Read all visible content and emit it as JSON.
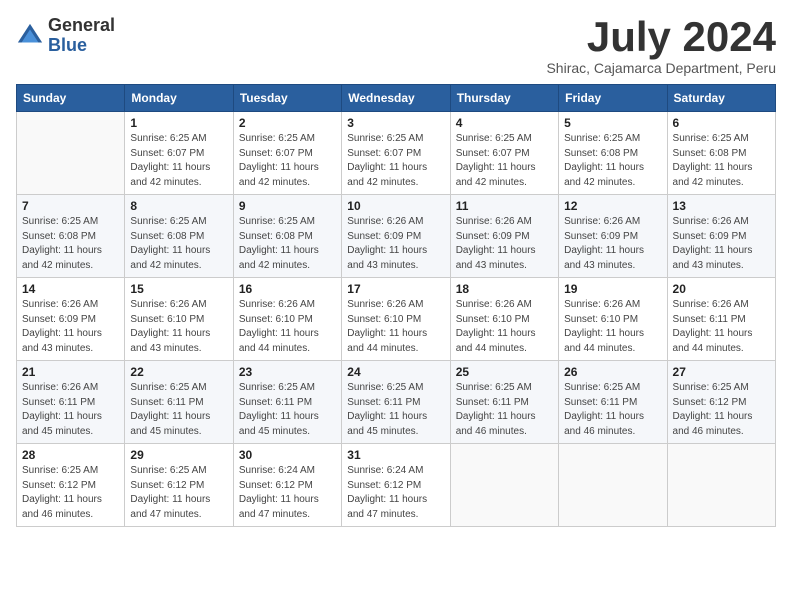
{
  "header": {
    "logo_general": "General",
    "logo_blue": "Blue",
    "month_title": "July 2024",
    "subtitle": "Shirac, Cajamarca Department, Peru"
  },
  "days_of_week": [
    "Sunday",
    "Monday",
    "Tuesday",
    "Wednesday",
    "Thursday",
    "Friday",
    "Saturday"
  ],
  "weeks": [
    [
      {
        "day": "",
        "info": ""
      },
      {
        "day": "1",
        "info": "Sunrise: 6:25 AM\nSunset: 6:07 PM\nDaylight: 11 hours\nand 42 minutes."
      },
      {
        "day": "2",
        "info": "Sunrise: 6:25 AM\nSunset: 6:07 PM\nDaylight: 11 hours\nand 42 minutes."
      },
      {
        "day": "3",
        "info": "Sunrise: 6:25 AM\nSunset: 6:07 PM\nDaylight: 11 hours\nand 42 minutes."
      },
      {
        "day": "4",
        "info": "Sunrise: 6:25 AM\nSunset: 6:07 PM\nDaylight: 11 hours\nand 42 minutes."
      },
      {
        "day": "5",
        "info": "Sunrise: 6:25 AM\nSunset: 6:08 PM\nDaylight: 11 hours\nand 42 minutes."
      },
      {
        "day": "6",
        "info": "Sunrise: 6:25 AM\nSunset: 6:08 PM\nDaylight: 11 hours\nand 42 minutes."
      }
    ],
    [
      {
        "day": "7",
        "info": "Sunrise: 6:25 AM\nSunset: 6:08 PM\nDaylight: 11 hours\nand 42 minutes."
      },
      {
        "day": "8",
        "info": "Sunrise: 6:25 AM\nSunset: 6:08 PM\nDaylight: 11 hours\nand 42 minutes."
      },
      {
        "day": "9",
        "info": "Sunrise: 6:25 AM\nSunset: 6:08 PM\nDaylight: 11 hours\nand 42 minutes."
      },
      {
        "day": "10",
        "info": "Sunrise: 6:26 AM\nSunset: 6:09 PM\nDaylight: 11 hours\nand 43 minutes."
      },
      {
        "day": "11",
        "info": "Sunrise: 6:26 AM\nSunset: 6:09 PM\nDaylight: 11 hours\nand 43 minutes."
      },
      {
        "day": "12",
        "info": "Sunrise: 6:26 AM\nSunset: 6:09 PM\nDaylight: 11 hours\nand 43 minutes."
      },
      {
        "day": "13",
        "info": "Sunrise: 6:26 AM\nSunset: 6:09 PM\nDaylight: 11 hours\nand 43 minutes."
      }
    ],
    [
      {
        "day": "14",
        "info": "Sunrise: 6:26 AM\nSunset: 6:09 PM\nDaylight: 11 hours\nand 43 minutes."
      },
      {
        "day": "15",
        "info": "Sunrise: 6:26 AM\nSunset: 6:10 PM\nDaylight: 11 hours\nand 43 minutes."
      },
      {
        "day": "16",
        "info": "Sunrise: 6:26 AM\nSunset: 6:10 PM\nDaylight: 11 hours\nand 44 minutes."
      },
      {
        "day": "17",
        "info": "Sunrise: 6:26 AM\nSunset: 6:10 PM\nDaylight: 11 hours\nand 44 minutes."
      },
      {
        "day": "18",
        "info": "Sunrise: 6:26 AM\nSunset: 6:10 PM\nDaylight: 11 hours\nand 44 minutes."
      },
      {
        "day": "19",
        "info": "Sunrise: 6:26 AM\nSunset: 6:10 PM\nDaylight: 11 hours\nand 44 minutes."
      },
      {
        "day": "20",
        "info": "Sunrise: 6:26 AM\nSunset: 6:11 PM\nDaylight: 11 hours\nand 44 minutes."
      }
    ],
    [
      {
        "day": "21",
        "info": "Sunrise: 6:26 AM\nSunset: 6:11 PM\nDaylight: 11 hours\nand 45 minutes."
      },
      {
        "day": "22",
        "info": "Sunrise: 6:25 AM\nSunset: 6:11 PM\nDaylight: 11 hours\nand 45 minutes."
      },
      {
        "day": "23",
        "info": "Sunrise: 6:25 AM\nSunset: 6:11 PM\nDaylight: 11 hours\nand 45 minutes."
      },
      {
        "day": "24",
        "info": "Sunrise: 6:25 AM\nSunset: 6:11 PM\nDaylight: 11 hours\nand 45 minutes."
      },
      {
        "day": "25",
        "info": "Sunrise: 6:25 AM\nSunset: 6:11 PM\nDaylight: 11 hours\nand 46 minutes."
      },
      {
        "day": "26",
        "info": "Sunrise: 6:25 AM\nSunset: 6:11 PM\nDaylight: 11 hours\nand 46 minutes."
      },
      {
        "day": "27",
        "info": "Sunrise: 6:25 AM\nSunset: 6:12 PM\nDaylight: 11 hours\nand 46 minutes."
      }
    ],
    [
      {
        "day": "28",
        "info": "Sunrise: 6:25 AM\nSunset: 6:12 PM\nDaylight: 11 hours\nand 46 minutes."
      },
      {
        "day": "29",
        "info": "Sunrise: 6:25 AM\nSunset: 6:12 PM\nDaylight: 11 hours\nand 47 minutes."
      },
      {
        "day": "30",
        "info": "Sunrise: 6:24 AM\nSunset: 6:12 PM\nDaylight: 11 hours\nand 47 minutes."
      },
      {
        "day": "31",
        "info": "Sunrise: 6:24 AM\nSunset: 6:12 PM\nDaylight: 11 hours\nand 47 minutes."
      },
      {
        "day": "",
        "info": ""
      },
      {
        "day": "",
        "info": ""
      },
      {
        "day": "",
        "info": ""
      }
    ]
  ]
}
